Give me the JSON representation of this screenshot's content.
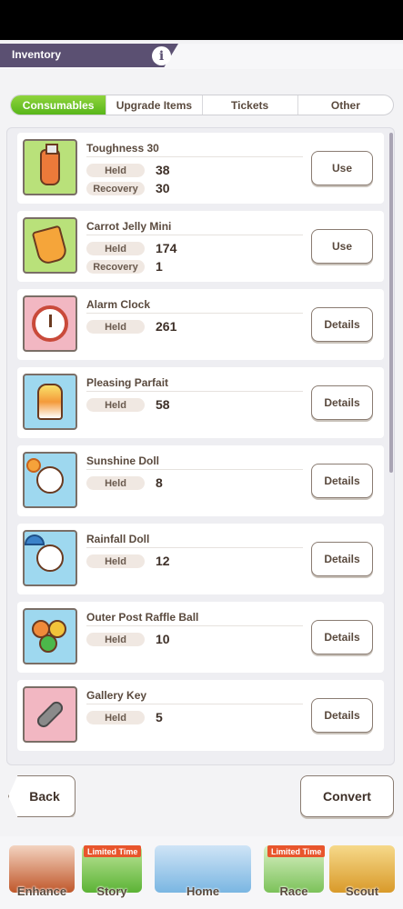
{
  "header": {
    "title": "Inventory",
    "info_icon": "info-icon"
  },
  "tabs": [
    {
      "label": "Consumables",
      "active": true
    },
    {
      "label": "Upgrade Items",
      "active": false
    },
    {
      "label": "Tickets",
      "active": false
    },
    {
      "label": "Other",
      "active": false
    }
  ],
  "items": [
    {
      "name": "Toughness 30",
      "held_label": "Held",
      "held": "38",
      "recovery_label": "Recovery",
      "recovery": "30",
      "action": "Use",
      "icon": "energy-drink-icon"
    },
    {
      "name": "Carrot Jelly Mini",
      "held_label": "Held",
      "held": "174",
      "recovery_label": "Recovery",
      "recovery": "1",
      "action": "Use",
      "icon": "jelly-pouch-icon"
    },
    {
      "name": "Alarm Clock",
      "held_label": "Held",
      "held": "261",
      "action": "Details",
      "icon": "alarm-clock-icon"
    },
    {
      "name": "Pleasing Parfait",
      "held_label": "Held",
      "held": "58",
      "action": "Details",
      "icon": "parfait-icon"
    },
    {
      "name": "Sunshine Doll",
      "held_label": "Held",
      "held": "8",
      "action": "Details",
      "icon": "sunshine-doll-icon"
    },
    {
      "name": "Rainfall Doll",
      "held_label": "Held",
      "held": "12",
      "action": "Details",
      "icon": "rainfall-doll-icon"
    },
    {
      "name": "Outer Post Raffle Ball",
      "held_label": "Held",
      "held": "10",
      "action": "Details",
      "icon": "raffle-ball-icon"
    },
    {
      "name": "Gallery Key",
      "held_label": "Held",
      "held": "5",
      "action": "Details",
      "icon": "key-icon"
    }
  ],
  "footer": {
    "back_label": "Back",
    "convert_label": "Convert"
  },
  "nav": [
    {
      "label": "Enhance",
      "badge": ""
    },
    {
      "label": "Story",
      "badge": "Limited Time"
    },
    {
      "label": "Home",
      "badge": ""
    },
    {
      "label": "Race",
      "badge": "Limited Time"
    },
    {
      "label": "Scout",
      "badge": ""
    }
  ],
  "colors": {
    "accent_green": "#6cc12a",
    "header_purple": "#5b5072",
    "badge_orange": "#e8552c"
  }
}
